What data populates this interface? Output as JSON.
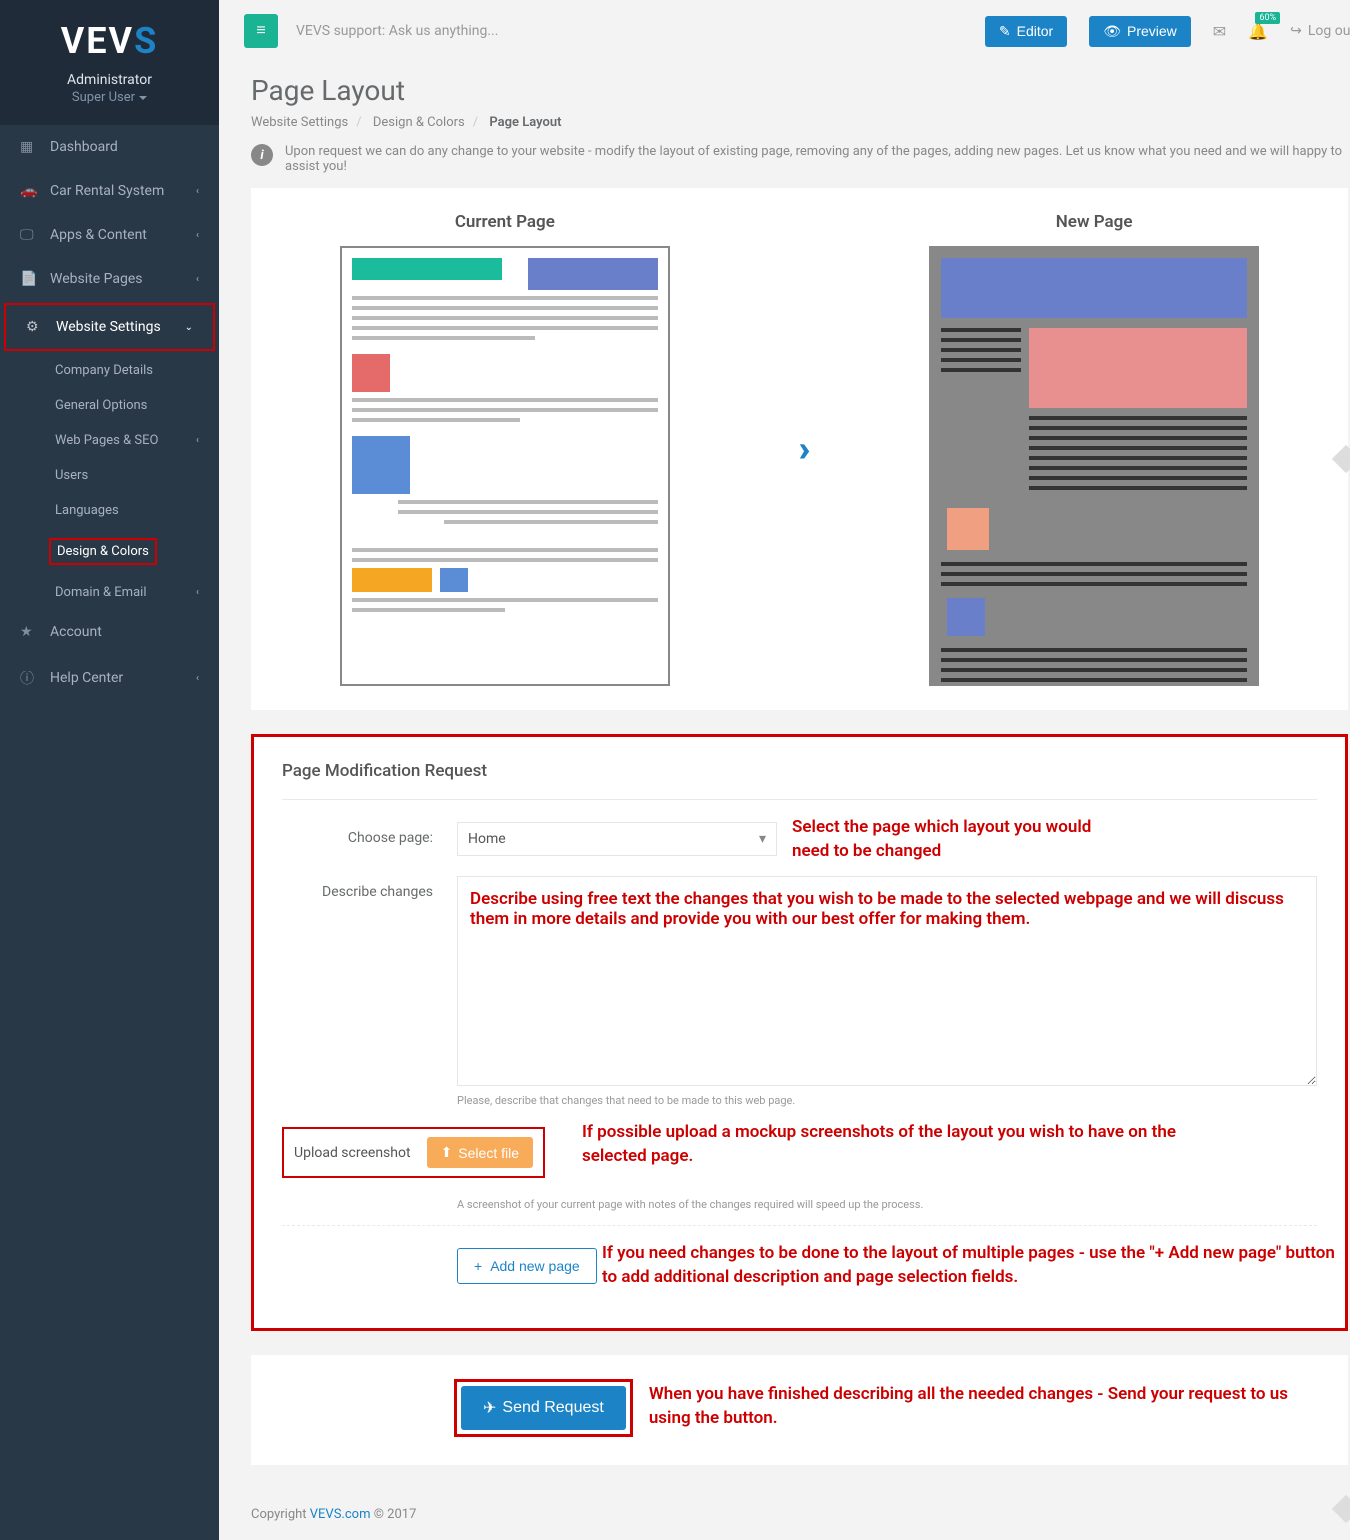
{
  "brand": {
    "name_prefix": "VEV",
    "name_suffix": "S"
  },
  "user": {
    "role": "Administrator",
    "type": "Super User"
  },
  "topbar": {
    "search_placeholder": "VEVS support: Ask us anything...",
    "editor": "Editor",
    "preview": "Preview",
    "badge": "60%",
    "logout": "Log out"
  },
  "nav": {
    "dashboard": "Dashboard",
    "car_rental": "Car Rental System",
    "apps_content": "Apps & Content",
    "website_pages": "Website Pages",
    "website_settings": "Website Settings",
    "account": "Account",
    "help_center": "Help Center",
    "sub": {
      "company_details": "Company Details",
      "general_options": "General Options",
      "web_pages_seo": "Web Pages & SEO",
      "users": "Users",
      "languages": "Languages",
      "design_colors": "Design & Colors",
      "domain_email": "Domain & Email"
    }
  },
  "page": {
    "title": "Page Layout",
    "breadcrumb": {
      "a": "Website Settings",
      "b": "Design & Colors",
      "c": "Page Layout"
    },
    "info": "Upon request we can do any change to your website - modify the layout of existing page, removing any of the pages, adding new pages. Let us know what you need and we will happy to assist you!"
  },
  "compare": {
    "current": "Current Page",
    "new": "New Page"
  },
  "form": {
    "title": "Page Modification Request",
    "choose_page_label": "Choose page:",
    "choose_page_value": "Home",
    "describe_label": "Describe changes",
    "describe_value": "Describe using free text the changes that you wish to be made to the selected webpage and we will discuss them in more details and provide you with our best offer for making them.",
    "describe_help": "Please, describe that changes that need to be made to this web page.",
    "upload_label": "Upload screenshot",
    "select_file": "Select file",
    "upload_help": "A screenshot of your current page with notes of the changes required will speed up the process.",
    "add_new_page": "Add new page",
    "send_request": "Send Request"
  },
  "annotations": {
    "choose": "Select the page which layout you would need to be changed",
    "upload": "If possible upload a mockup screenshots of the layout you wish to have on the selected page.",
    "add": "If you need changes to be done to the layout of multiple pages - use the \"+ Add new page\" button to add additional description and page selection fields.",
    "send": "When you have finished describing all the needed changes - Send your request to us using the button."
  },
  "footer": {
    "copyright": "Copyright ",
    "link": "VEVS.com",
    "year": " © 2017"
  }
}
